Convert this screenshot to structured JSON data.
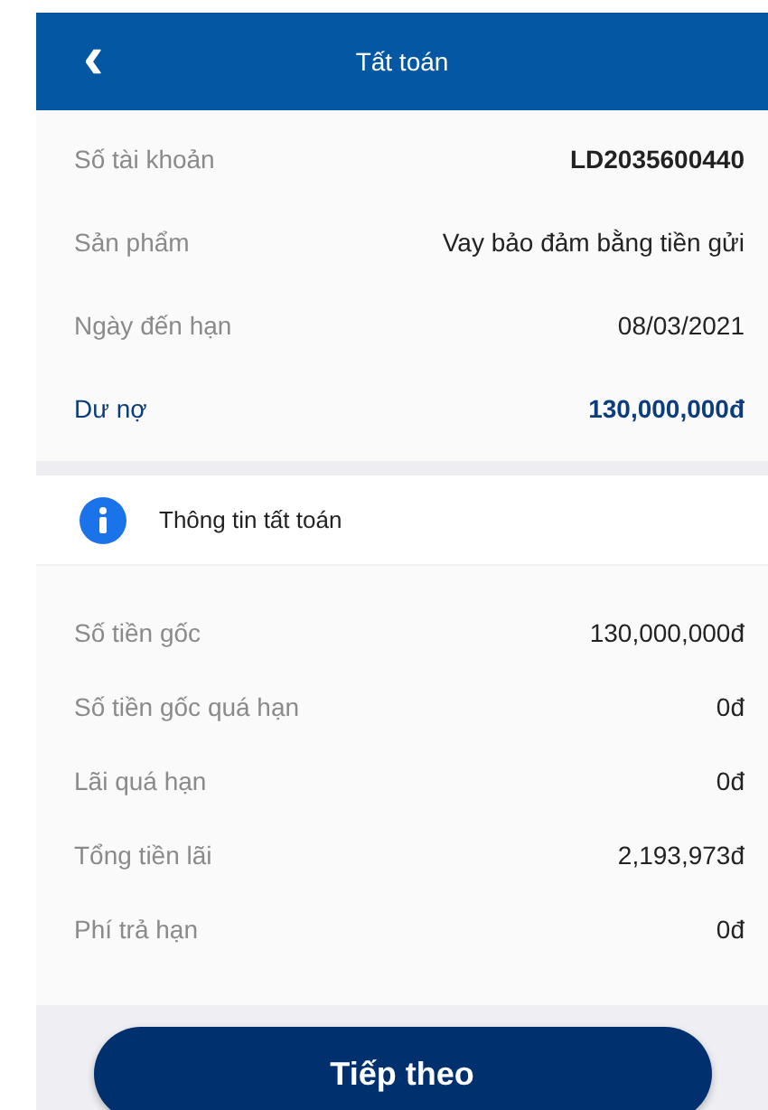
{
  "header": {
    "back": "‹",
    "title": "Tất toán"
  },
  "account_rows": [
    {
      "label": "Số tài khoản",
      "value": "LD2035600440",
      "kind": "strong"
    },
    {
      "label": "Sản phẩm",
      "value": "Vay bảo đảm bằng tiền gửi",
      "kind": "plain"
    },
    {
      "label": "Ngày đến hạn",
      "value": "08/03/2021",
      "kind": "plain"
    },
    {
      "label": "Dư nợ",
      "value": "130,000,000đ",
      "kind": "highlight"
    }
  ],
  "settlement": {
    "title": "Thông tin tất toán",
    "rows": [
      {
        "label": "Số tiền gốc",
        "value": "130,000,000đ"
      },
      {
        "label": "Số tiền gốc quá hạn",
        "value": "0đ"
      },
      {
        "label": "Lãi quá hạn",
        "value": "0đ"
      },
      {
        "label": "Tổng tiền lãi",
        "value": "2,193,973đ"
      },
      {
        "label": "Phí trả hạn",
        "value": "0đ"
      }
    ]
  },
  "next_button": "Tiếp theo"
}
